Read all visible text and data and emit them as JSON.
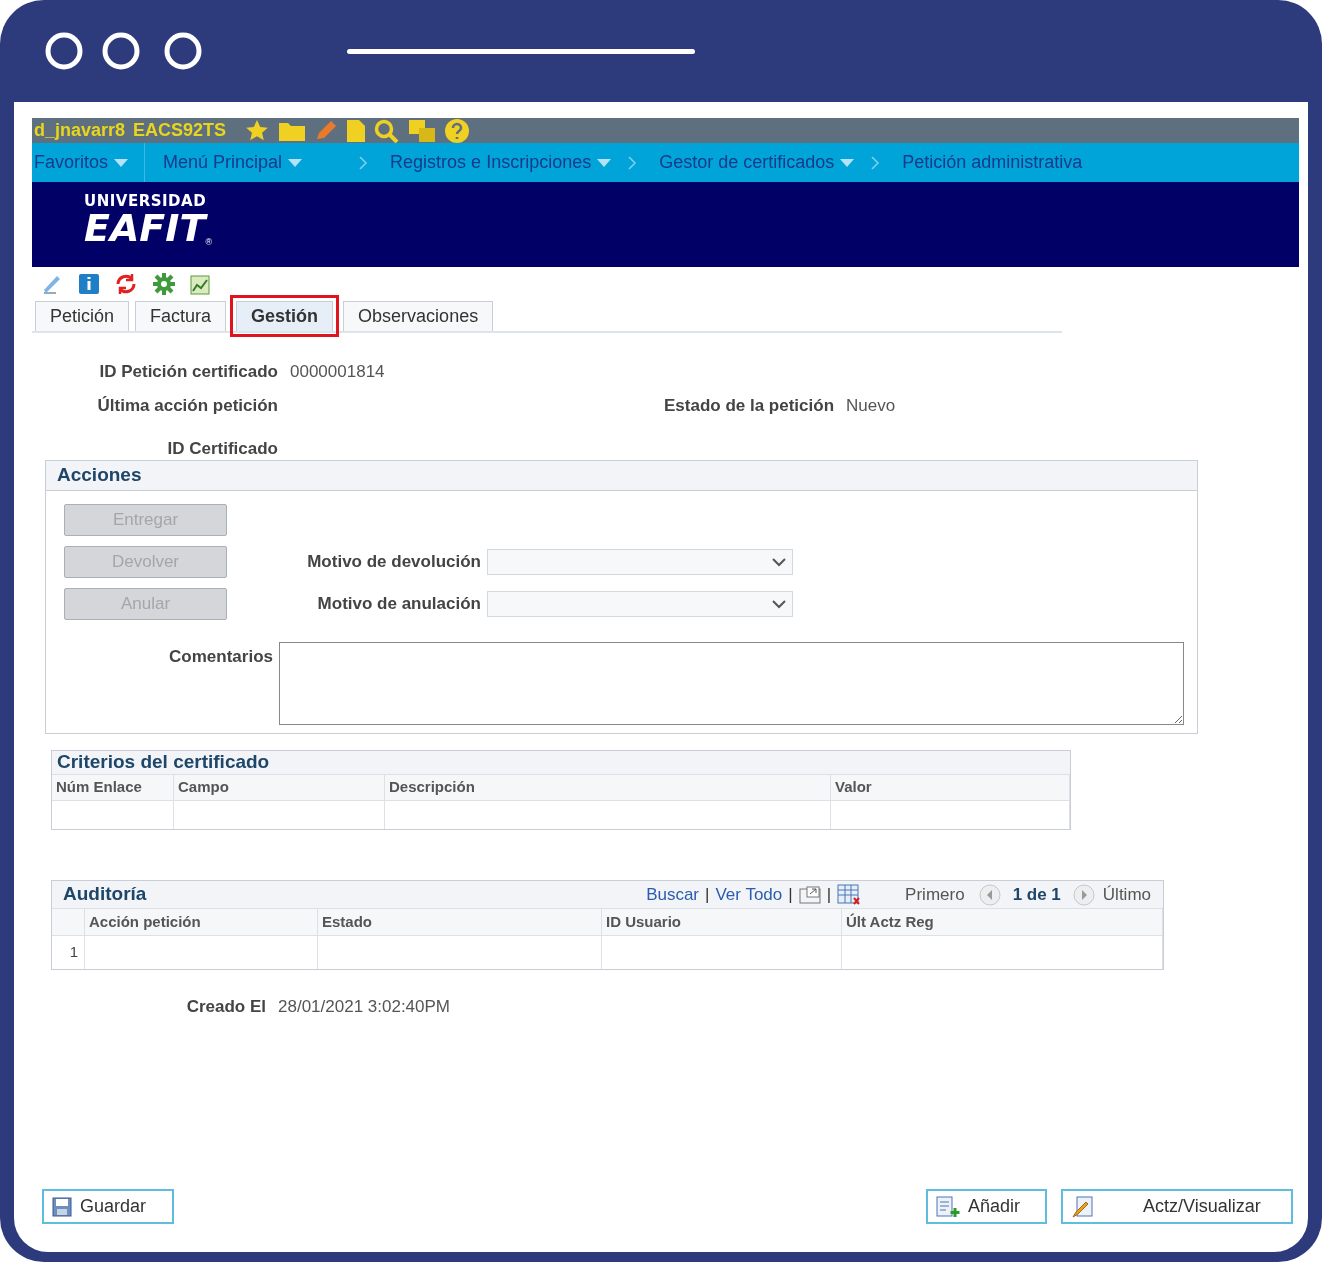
{
  "user_bar": {
    "user": "d_jnavarr8",
    "system": "EACS92TS"
  },
  "breadcrumb": [
    {
      "label": "Favoritos",
      "dropdown": true
    },
    {
      "label": "Menú Principal",
      "dropdown": true
    },
    {
      "label": "Registros e Inscripciones",
      "dropdown": true
    },
    {
      "label": "Gestor de certificados",
      "dropdown": true
    },
    {
      "label": "Petición administrativa",
      "dropdown": false
    }
  ],
  "logo": {
    "top": "UNIVERSIDAD",
    "name": "EAFIT",
    "mark": "®"
  },
  "tabs": [
    {
      "label": "Petición",
      "selected": false,
      "highlighted": false
    },
    {
      "label": "Factura",
      "selected": false,
      "highlighted": false
    },
    {
      "label": "Gestión",
      "selected": true,
      "highlighted": true
    },
    {
      "label": "Observaciones",
      "selected": false,
      "highlighted": false
    }
  ],
  "header_rows": [
    [
      {
        "label": "ID Petición certificado",
        "value": "0000001814"
      }
    ],
    [
      {
        "label": "Última acción petición"
      },
      {
        "label": "Estado de la petición",
        "value": "Nuevo"
      }
    ],
    [
      {
        "label": "ID Certificado"
      }
    ]
  ],
  "acciones": {
    "title": "Acciones",
    "buttons": [
      {
        "label": "Entregar",
        "disabled": true
      },
      {
        "label": "Devolver",
        "disabled": true
      },
      {
        "label": "Anular",
        "disabled": true
      }
    ],
    "selects": [
      {
        "label": "Motivo de devolución"
      },
      {
        "label": "Motivo de anulación"
      }
    ],
    "comments_label": "Comentarios"
  },
  "criterios": {
    "title": "Criterios del certificado",
    "columns": [
      "Núm Enlace",
      "Campo",
      "Descripción",
      "Valor"
    ]
  },
  "auditoria": {
    "title": "Auditoría",
    "links": [
      "Buscar",
      "Ver Todo"
    ],
    "separator": "|",
    "first": "Primero",
    "count": "1 de 1",
    "last": "Último",
    "columns": [
      "Acción petición",
      "Estado",
      "ID Usuario",
      "Últ Actz Reg"
    ],
    "rows": [
      {
        "number": "1"
      }
    ]
  },
  "created": {
    "label": "Creado El",
    "value": "28/01/2021  3:02:40PM"
  },
  "footer": {
    "left": [
      {
        "label": "Guardar",
        "kind": "save"
      }
    ],
    "right": [
      {
        "label": "Añadir",
        "kind": "add"
      },
      {
        "label": "Actz/Visualizar",
        "kind": "update"
      }
    ]
  }
}
